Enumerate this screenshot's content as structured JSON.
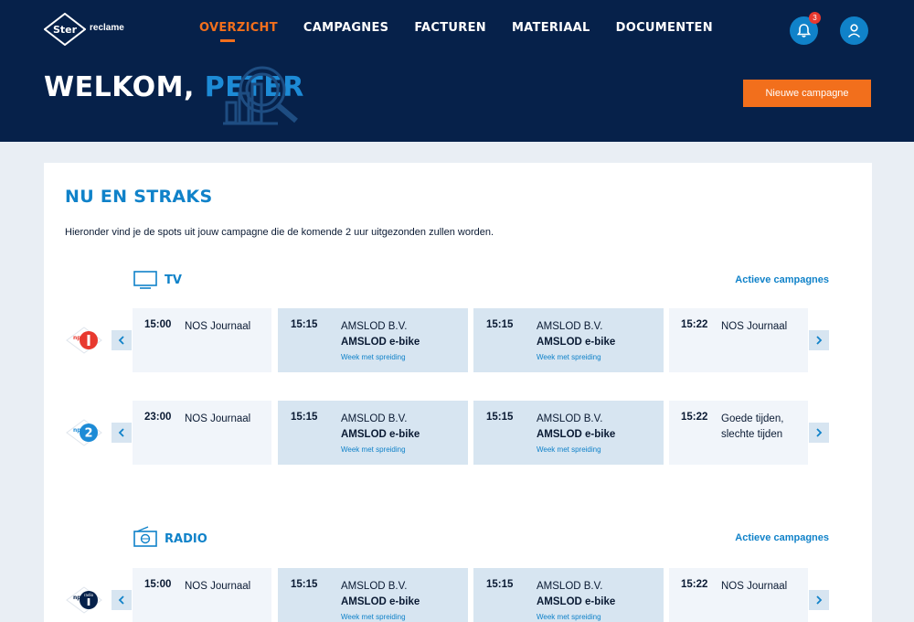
{
  "brand": {
    "logo_text": "Ster",
    "logo_sub": "reclame",
    "accent": "#f26f1c",
    "primary": "#06214a",
    "blue": "#1082c9"
  },
  "nav": [
    "OVERZICHT",
    "CAMPAGNES",
    "FACTUREN",
    "MATERIAAL",
    "DOCUMENTEN"
  ],
  "notifications": {
    "count": "3"
  },
  "welcome": {
    "prefix": "WELKOM, ",
    "name": "PETER"
  },
  "new_campaign_label": "Nieuwe campagne",
  "card": {
    "title": "NU EN STRAKS",
    "intro": "Hieronder vind je de spots uit jouw campagne die de komende 2 uur uitgezonden zullen worden."
  },
  "sections": [
    {
      "label": "TV",
      "link": "Actieve campagnes",
      "icon": "tv-icon",
      "rows": [
        {
          "channel": "NPO 1",
          "slots": [
            {
              "time": "15:00",
              "program": "NOS Journaal"
            },
            {
              "time": "15:15",
              "program": "AMSLOD B.V.",
              "product": "AMSLOD e-bike",
              "spread": "Week met spreiding"
            },
            {
              "time": "15:15",
              "program": "AMSLOD B.V.",
              "product": "AMSLOD e-bike",
              "spread": "Week met spreiding"
            },
            {
              "time": "15:22",
              "program": "NOS Journaal"
            }
          ]
        },
        {
          "channel": "NPO 2",
          "slots": [
            {
              "time": "23:00",
              "program": "NOS Journaal"
            },
            {
              "time": "15:15",
              "program": "AMSLOD B.V.",
              "product": "AMSLOD e-bike",
              "spread": "Week met spreiding"
            },
            {
              "time": "15:15",
              "program": "AMSLOD B.V.",
              "product": "AMSLOD e-bike",
              "spread": "Week met spreiding"
            },
            {
              "time": "15:22",
              "program": "Goede tijden, slechte tijden"
            }
          ]
        }
      ]
    },
    {
      "label": "RADIO",
      "link": "Actieve campagnes",
      "icon": "radio-icon",
      "rows": [
        {
          "channel": "NPO Radio 1",
          "slots": [
            {
              "time": "15:00",
              "program": "NOS Journaal"
            },
            {
              "time": "15:15",
              "program": "AMSLOD B.V.",
              "product": "AMSLOD e-bike",
              "spread": "Week met spreiding"
            },
            {
              "time": "15:15",
              "program": "AMSLOD B.V.",
              "product": "AMSLOD e-bike",
              "spread": "Week met spreiding"
            },
            {
              "time": "15:22",
              "program": "NOS Journaal"
            }
          ]
        }
      ]
    }
  ]
}
